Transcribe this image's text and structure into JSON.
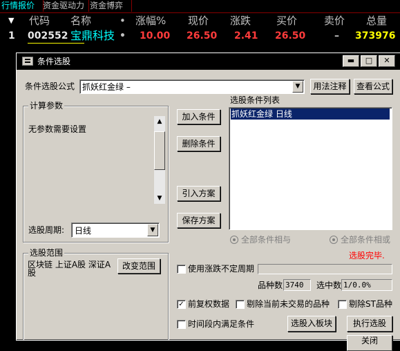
{
  "tabs": [
    "行情报价",
    "资金驱动力",
    "资金博弈"
  ],
  "quote_table": {
    "headers": {
      "arrow": "▼",
      "code": "代码",
      "name": "名称",
      "dot": "•",
      "change_pct": "涨幅%",
      "price": "现价",
      "change": "涨跌",
      "bid": "买价",
      "ask": "卖价",
      "volume": "总量"
    },
    "row": {
      "index": "1",
      "code": "002552",
      "name": "宝鼎科技",
      "dot": "•",
      "change_pct": "10.00",
      "price": "26.50",
      "change": "2.41",
      "bid": "26.50",
      "ask": "–",
      "volume": "373976"
    }
  },
  "dialog": {
    "title": "条件选股",
    "window_buttons": {
      "minimize": "▬",
      "maximize": "□",
      "close": "✕"
    },
    "formula_label": "条件选股公式",
    "formula_value": "抓妖红金绿    –",
    "usage_button": "用法注释",
    "view_formula_button": "查看公式",
    "params_group": "计算参数",
    "params_text": "无参数需要设置",
    "period_label": "选股周期:",
    "period_value": "日线",
    "add_condition_button": "加入条件",
    "delete_condition_button": "删除条件",
    "import_plan_button": "引入方案",
    "save_plan_button": "保存方案",
    "condition_list_label": "选股条件列表",
    "condition_list_items": [
      "抓妖红金绿  日线"
    ],
    "radio_and": "全部条件相与",
    "radio_or": "全部条件相或",
    "status_text": "选股完毕.",
    "range_group": "选股范围",
    "range_text": "区块链 上证A股 深证A股",
    "change_range_button": "改变范围",
    "variable_period_label": "使用涨跌不定周期",
    "stock_count_label": "品种数",
    "stock_count_value": "3740",
    "selected_label": "选中数",
    "selected_value": "1/0.0%",
    "pre_adjust_label": "前复权数据",
    "pre_adjust_checked": true,
    "exclude_untraded_label": "剔除当前未交易的品种",
    "exclude_st_label": "剔除ST品种",
    "time_range_label": "时间段内满足条件",
    "to_block_button": "选股入板块",
    "execute_button": "执行选股",
    "close_button": "关闭"
  },
  "colors": {
    "up_red": "#ff3b3b",
    "name_cyan": "#00ffff",
    "code_white": "#e8e8e8",
    "volume_yellow": "#ffff00",
    "selection_blue": "#0a246a",
    "status_red": "#ff0000"
  }
}
